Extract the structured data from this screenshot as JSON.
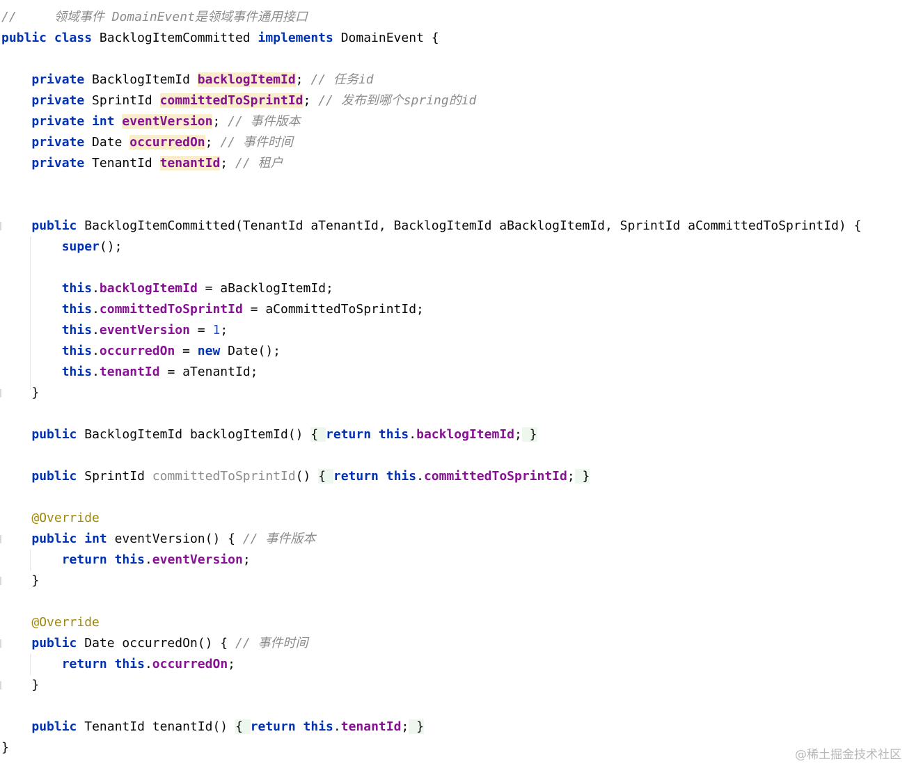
{
  "colors": {
    "background": "#ffffff",
    "keyword": "#0033b3",
    "field": "#871094",
    "comment": "#8c8c8c",
    "number": "#1750eb",
    "annotation": "#9e880d",
    "highlight": "#faedcb",
    "fold_highlight": "#edf7ed"
  },
  "lines": [
    {
      "tokens": [
        {
          "t": "//     ",
          "c": "comment"
        },
        {
          "t": "领域事件 DomainEvent是领域事件通用接口",
          "c": "comment"
        }
      ]
    },
    {
      "tokens": [
        {
          "t": "public",
          "c": "kw"
        },
        {
          "t": " ",
          "c": "plain"
        },
        {
          "t": "class",
          "c": "kw"
        },
        {
          "t": " BacklogItemCommitted ",
          "c": "plain"
        },
        {
          "t": "implements",
          "c": "kw"
        },
        {
          "t": " DomainEvent {",
          "c": "plain"
        }
      ]
    },
    {
      "tokens": []
    },
    {
      "tokens": [
        {
          "t": "    ",
          "c": "plain"
        },
        {
          "t": "private",
          "c": "kw"
        },
        {
          "t": " BacklogItemId ",
          "c": "plain"
        },
        {
          "t": "backlogItemId",
          "c": "field-decl"
        },
        {
          "t": "; ",
          "c": "plain"
        },
        {
          "t": "// 任务id",
          "c": "comment"
        }
      ]
    },
    {
      "tokens": [
        {
          "t": "    ",
          "c": "plain"
        },
        {
          "t": "private",
          "c": "kw"
        },
        {
          "t": " SprintId ",
          "c": "plain"
        },
        {
          "t": "committedToSprintId",
          "c": "field-decl"
        },
        {
          "t": "; ",
          "c": "plain"
        },
        {
          "t": "// 发布到哪个spring的id",
          "c": "comment"
        }
      ]
    },
    {
      "tokens": [
        {
          "t": "    ",
          "c": "plain"
        },
        {
          "t": "private",
          "c": "kw"
        },
        {
          "t": " ",
          "c": "plain"
        },
        {
          "t": "int",
          "c": "kw"
        },
        {
          "t": " ",
          "c": "plain"
        },
        {
          "t": "eventVersion",
          "c": "field-decl"
        },
        {
          "t": "; ",
          "c": "plain"
        },
        {
          "t": "// 事件版本",
          "c": "comment"
        }
      ]
    },
    {
      "tokens": [
        {
          "t": "    ",
          "c": "plain"
        },
        {
          "t": "private",
          "c": "kw"
        },
        {
          "t": " Date ",
          "c": "plain"
        },
        {
          "t": "occurredOn",
          "c": "field-decl"
        },
        {
          "t": "; ",
          "c": "plain"
        },
        {
          "t": "// 事件时间",
          "c": "comment"
        }
      ]
    },
    {
      "tokens": [
        {
          "t": "    ",
          "c": "plain"
        },
        {
          "t": "private",
          "c": "kw"
        },
        {
          "t": " TenantId ",
          "c": "plain"
        },
        {
          "t": "tenantId",
          "c": "field-decl"
        },
        {
          "t": "; ",
          "c": "plain"
        },
        {
          "t": "// 租户",
          "c": "comment"
        }
      ]
    },
    {
      "tokens": []
    },
    {
      "tokens": []
    },
    {
      "tokens": [
        {
          "t": "    ",
          "c": "plain"
        },
        {
          "t": "public",
          "c": "kw"
        },
        {
          "t": " BacklogItemCommitted(TenantId aTenantId, BacklogItemId aBacklogItemId, SprintId aCommittedToSprintId) {",
          "c": "plain"
        }
      ]
    },
    {
      "tokens": [
        {
          "t": "        ",
          "c": "plain"
        },
        {
          "t": "super",
          "c": "kw"
        },
        {
          "t": "();",
          "c": "plain"
        }
      ]
    },
    {
      "tokens": []
    },
    {
      "tokens": [
        {
          "t": "        ",
          "c": "plain"
        },
        {
          "t": "this",
          "c": "kw"
        },
        {
          "t": ".",
          "c": "plain"
        },
        {
          "t": "backlogItemId",
          "c": "field"
        },
        {
          "t": " = aBacklogItemId;",
          "c": "plain"
        }
      ]
    },
    {
      "tokens": [
        {
          "t": "        ",
          "c": "plain"
        },
        {
          "t": "this",
          "c": "kw"
        },
        {
          "t": ".",
          "c": "plain"
        },
        {
          "t": "committedToSprintId",
          "c": "field"
        },
        {
          "t": " = aCommittedToSprintId;",
          "c": "plain"
        }
      ]
    },
    {
      "tokens": [
        {
          "t": "        ",
          "c": "plain"
        },
        {
          "t": "this",
          "c": "kw"
        },
        {
          "t": ".",
          "c": "plain"
        },
        {
          "t": "eventVersion",
          "c": "field"
        },
        {
          "t": " = ",
          "c": "plain"
        },
        {
          "t": "1",
          "c": "num"
        },
        {
          "t": ";",
          "c": "plain"
        }
      ]
    },
    {
      "tokens": [
        {
          "t": "        ",
          "c": "plain"
        },
        {
          "t": "this",
          "c": "kw"
        },
        {
          "t": ".",
          "c": "plain"
        },
        {
          "t": "occurredOn",
          "c": "field"
        },
        {
          "t": " = ",
          "c": "plain"
        },
        {
          "t": "new",
          "c": "kw"
        },
        {
          "t": " Date();",
          "c": "plain"
        }
      ]
    },
    {
      "tokens": [
        {
          "t": "        ",
          "c": "plain"
        },
        {
          "t": "this",
          "c": "kw"
        },
        {
          "t": ".",
          "c": "plain"
        },
        {
          "t": "tenantId",
          "c": "field"
        },
        {
          "t": " = aTenantId;",
          "c": "plain"
        }
      ]
    },
    {
      "tokens": [
        {
          "t": "    }",
          "c": "plain"
        }
      ]
    },
    {
      "tokens": []
    },
    {
      "tokens": [
        {
          "t": "    ",
          "c": "plain"
        },
        {
          "t": "public",
          "c": "kw"
        },
        {
          "t": " BacklogItemId backlogItemId() ",
          "c": "plain"
        },
        {
          "t": "{ ",
          "c": "brace-fold"
        },
        {
          "t": "return",
          "c": "kw"
        },
        {
          "t": " ",
          "c": "plain"
        },
        {
          "t": "this",
          "c": "kw"
        },
        {
          "t": ".",
          "c": "plain"
        },
        {
          "t": "backlogItemId",
          "c": "field"
        },
        {
          "t": ";",
          "c": "plain"
        },
        {
          "t": " }",
          "c": "brace-fold"
        }
      ]
    },
    {
      "tokens": []
    },
    {
      "tokens": [
        {
          "t": "    ",
          "c": "plain"
        },
        {
          "t": "public",
          "c": "kw"
        },
        {
          "t": " SprintId ",
          "c": "plain"
        },
        {
          "t": "committedToSprintId",
          "c": "unused"
        },
        {
          "t": "() ",
          "c": "plain"
        },
        {
          "t": "{ ",
          "c": "brace-fold"
        },
        {
          "t": "return",
          "c": "kw"
        },
        {
          "t": " ",
          "c": "plain"
        },
        {
          "t": "this",
          "c": "kw"
        },
        {
          "t": ".",
          "c": "plain"
        },
        {
          "t": "committedToSprintId",
          "c": "field"
        },
        {
          "t": ";",
          "c": "plain"
        },
        {
          "t": " }",
          "c": "brace-fold"
        }
      ]
    },
    {
      "tokens": []
    },
    {
      "tokens": [
        {
          "t": "    ",
          "c": "plain"
        },
        {
          "t": "@Override",
          "c": "anno"
        }
      ]
    },
    {
      "tokens": [
        {
          "t": "    ",
          "c": "plain"
        },
        {
          "t": "public",
          "c": "kw"
        },
        {
          "t": " ",
          "c": "plain"
        },
        {
          "t": "int",
          "c": "kw"
        },
        {
          "t": " eventVersion() { ",
          "c": "plain"
        },
        {
          "t": "// 事件版本",
          "c": "comment"
        }
      ]
    },
    {
      "tokens": [
        {
          "t": "        ",
          "c": "plain"
        },
        {
          "t": "return",
          "c": "kw"
        },
        {
          "t": " ",
          "c": "plain"
        },
        {
          "t": "this",
          "c": "kw"
        },
        {
          "t": ".",
          "c": "plain"
        },
        {
          "t": "eventVersion",
          "c": "field"
        },
        {
          "t": ";",
          "c": "plain"
        }
      ]
    },
    {
      "tokens": [
        {
          "t": "    }",
          "c": "plain"
        }
      ]
    },
    {
      "tokens": []
    },
    {
      "tokens": [
        {
          "t": "    ",
          "c": "plain"
        },
        {
          "t": "@Override",
          "c": "anno"
        }
      ]
    },
    {
      "tokens": [
        {
          "t": "    ",
          "c": "plain"
        },
        {
          "t": "public",
          "c": "kw"
        },
        {
          "t": " Date occurredOn() { ",
          "c": "plain"
        },
        {
          "t": "// 事件时间",
          "c": "comment"
        }
      ]
    },
    {
      "tokens": [
        {
          "t": "        ",
          "c": "plain"
        },
        {
          "t": "return",
          "c": "kw"
        },
        {
          "t": " ",
          "c": "plain"
        },
        {
          "t": "this",
          "c": "kw"
        },
        {
          "t": ".",
          "c": "plain"
        },
        {
          "t": "occurredOn",
          "c": "field"
        },
        {
          "t": ";",
          "c": "plain"
        }
      ]
    },
    {
      "tokens": [
        {
          "t": "    }",
          "c": "plain"
        }
      ]
    },
    {
      "tokens": []
    },
    {
      "tokens": [
        {
          "t": "    ",
          "c": "plain"
        },
        {
          "t": "public",
          "c": "kw"
        },
        {
          "t": " TenantId tenantId() ",
          "c": "plain"
        },
        {
          "t": "{ ",
          "c": "brace-fold"
        },
        {
          "t": "return",
          "c": "kw"
        },
        {
          "t": " ",
          "c": "plain"
        },
        {
          "t": "this",
          "c": "kw"
        },
        {
          "t": ".",
          "c": "plain"
        },
        {
          "t": "tenantId",
          "c": "field"
        },
        {
          "t": ";",
          "c": "plain"
        },
        {
          "t": " }",
          "c": "brace-fold"
        }
      ]
    },
    {
      "tokens": [
        {
          "t": "}",
          "c": "plain"
        }
      ]
    }
  ],
  "watermark": "@稀土掘金技术社区"
}
